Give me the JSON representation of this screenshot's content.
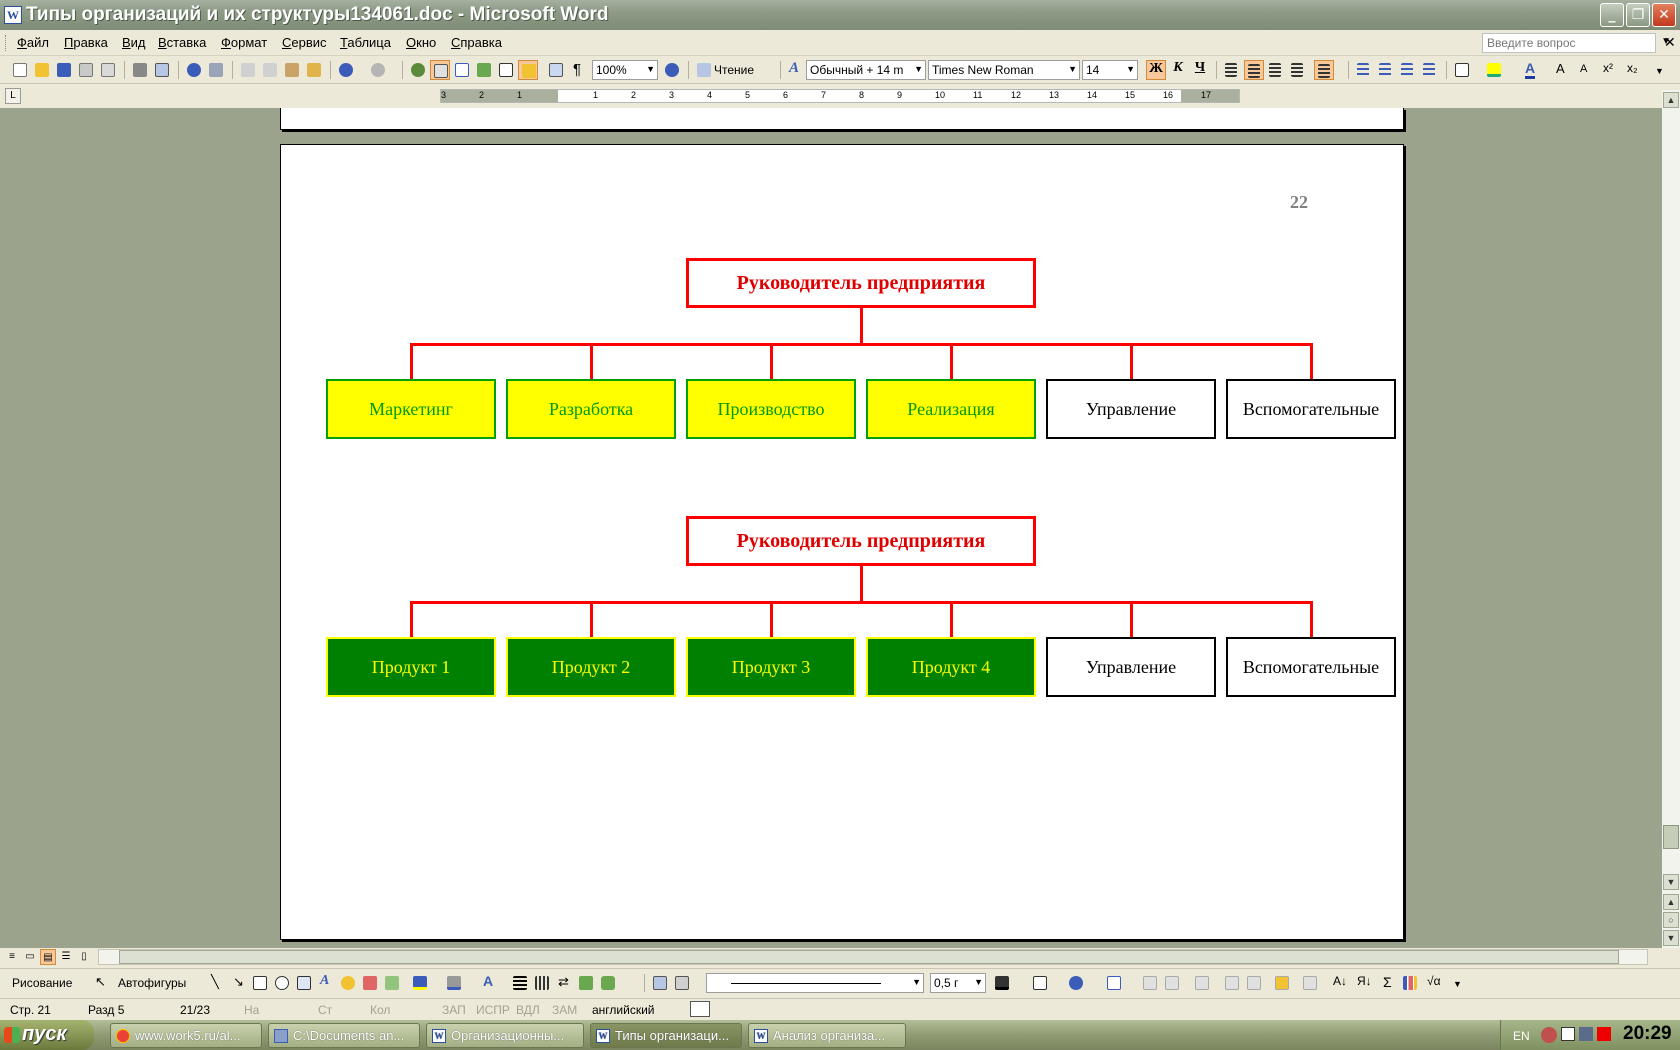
{
  "window": {
    "title": "Типы организаций и их структуры134061.doc - Microsoft Word",
    "icon": "word-doc-icon",
    "icon_letter": "W"
  },
  "menu": {
    "items": [
      "Файл",
      "Правка",
      "Вид",
      "Вставка",
      "Формат",
      "Сервис",
      "Таблица",
      "Окно",
      "Справка"
    ],
    "help_placeholder": "Введите вопрос"
  },
  "toolbar": {
    "zoom": "100%",
    "reading_button": "Чтение",
    "style": "Обычный + 14 m",
    "font": "Times New Roman",
    "size": "14",
    "bold_label": "Ж",
    "italic_label": "К",
    "underline_label": "Ч"
  },
  "ruler": {
    "labels": [
      "3",
      "2",
      "1",
      "1",
      "2",
      "3",
      "4",
      "5",
      "6",
      "7",
      "8",
      "9",
      "10",
      "11",
      "12",
      "13",
      "14",
      "15",
      "16",
      "17"
    ]
  },
  "document": {
    "page_number": "22",
    "chart1": {
      "head": "Руководитель предприятия",
      "boxes": [
        "Маркетинг",
        "Разработка",
        "Производство",
        "Реализация",
        "Управление",
        "Вспомогательные"
      ]
    },
    "chart2": {
      "head": "Руководитель предприятия",
      "boxes": [
        "Продукт 1",
        "Продукт 2",
        "Продукт 3",
        "Продукт 4",
        "Управление",
        "Вспомогательные"
      ]
    },
    "colors": {
      "head_border": "#ff0000",
      "connector": "#ff0000",
      "functional_fill": "#ffff00",
      "functional_text": "#009900",
      "product_fill": "#008000",
      "product_text": "#ffff00"
    }
  },
  "drawbar": {
    "drawing": "Рисование",
    "autoshapes": "Автофигуры",
    "line_width": "0,5 г"
  },
  "status": {
    "page": "Стр. 21",
    "section": "Разд 5",
    "pages": "21/23",
    "at": "На",
    "line": "Ст",
    "col": "Кол",
    "rec": "ЗАП",
    "trk": "ИСПР",
    "ext": "ВДЛ",
    "ovr": "ЗАМ",
    "language": "английский"
  },
  "taskbar": {
    "start": "пуск",
    "tasks": [
      "www.work5.ru/al...",
      "C:\\Documents an...",
      "Организационны...",
      "Типы организаци...",
      "Анализ организа..."
    ],
    "lang": "EN",
    "clock": "20:29"
  }
}
